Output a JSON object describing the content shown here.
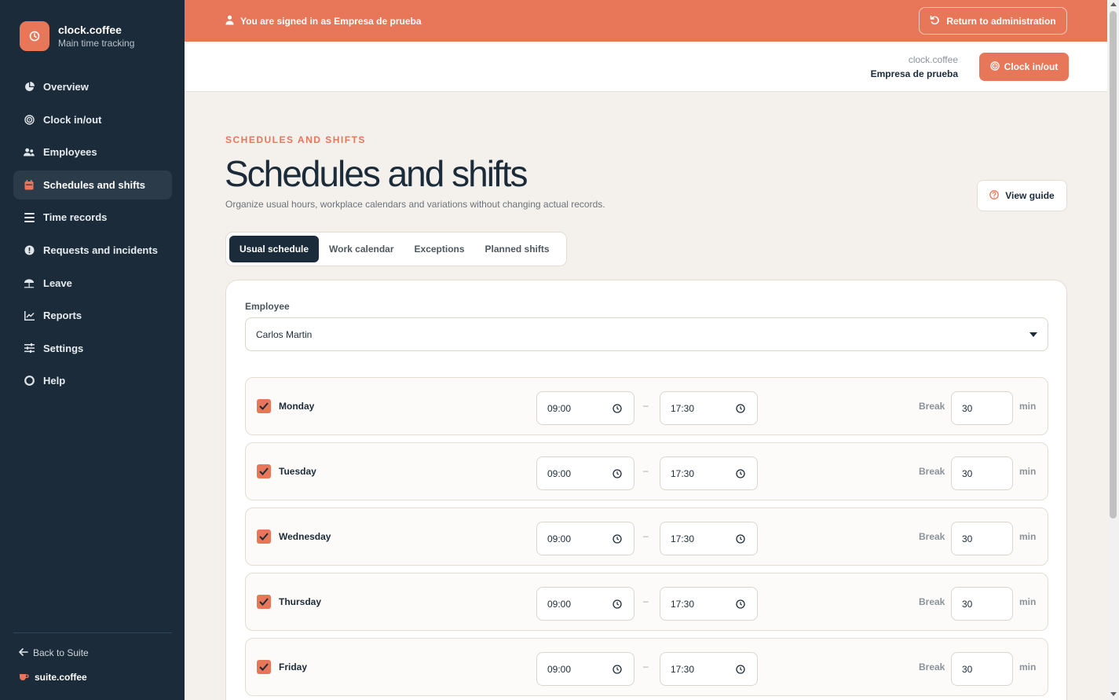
{
  "brand": {
    "name": "clock.coffee",
    "subtitle": "Main time tracking"
  },
  "nav": [
    {
      "label": "Overview",
      "icon": "pie-chart-icon"
    },
    {
      "label": "Clock in/out",
      "icon": "fingerprint-icon"
    },
    {
      "label": "Employees",
      "icon": "users-icon"
    },
    {
      "label": "Schedules and shifts",
      "icon": "calendar-icon",
      "active": true
    },
    {
      "label": "Time records",
      "icon": "list-icon"
    },
    {
      "label": "Requests and incidents",
      "icon": "alert-circle-icon"
    },
    {
      "label": "Leave",
      "icon": "umbrella-icon"
    },
    {
      "label": "Reports",
      "icon": "bar-chart-icon"
    },
    {
      "label": "Settings",
      "icon": "sliders-icon"
    },
    {
      "label": "Help",
      "icon": "lifebuoy-icon"
    }
  ],
  "footer": {
    "back_label": "Back to Suite",
    "suite_name": "suite.coffee"
  },
  "banner": {
    "text": "You are signed in as Empresa de prueba",
    "return_label": "Return to administration"
  },
  "header": {
    "app": "clock.coffee",
    "org": "Empresa de prueba",
    "clock_label": "Clock in/out"
  },
  "page": {
    "eyebrow": "SCHEDULES AND SHIFTS",
    "title": "Schedules and shifts",
    "subtitle": "Organize usual hours, workplace calendars and variations without changing actual records.",
    "guide_label": "View guide"
  },
  "tabs": [
    {
      "label": "Usual schedule",
      "active": true
    },
    {
      "label": "Work calendar"
    },
    {
      "label": "Exceptions"
    },
    {
      "label": "Planned shifts"
    }
  ],
  "form": {
    "employee_label": "Employee",
    "employee_value": "Carlos Martin",
    "break_label": "Break",
    "min_label": "min",
    "dash": "–",
    "days": [
      {
        "name": "Monday",
        "checked": true,
        "start": "09:00",
        "end": "17:30",
        "break": "30"
      },
      {
        "name": "Tuesday",
        "checked": true,
        "start": "09:00",
        "end": "17:30",
        "break": "30"
      },
      {
        "name": "Wednesday",
        "checked": true,
        "start": "09:00",
        "end": "17:30",
        "break": "30"
      },
      {
        "name": "Thursday",
        "checked": true,
        "start": "09:00",
        "end": "17:30",
        "break": "30"
      },
      {
        "name": "Friday",
        "checked": true,
        "start": "09:00",
        "end": "17:30",
        "break": "30"
      }
    ]
  },
  "colors": {
    "accent": "#e8775a",
    "sidebar": "#1b2b39",
    "background": "#f4f1ec"
  }
}
